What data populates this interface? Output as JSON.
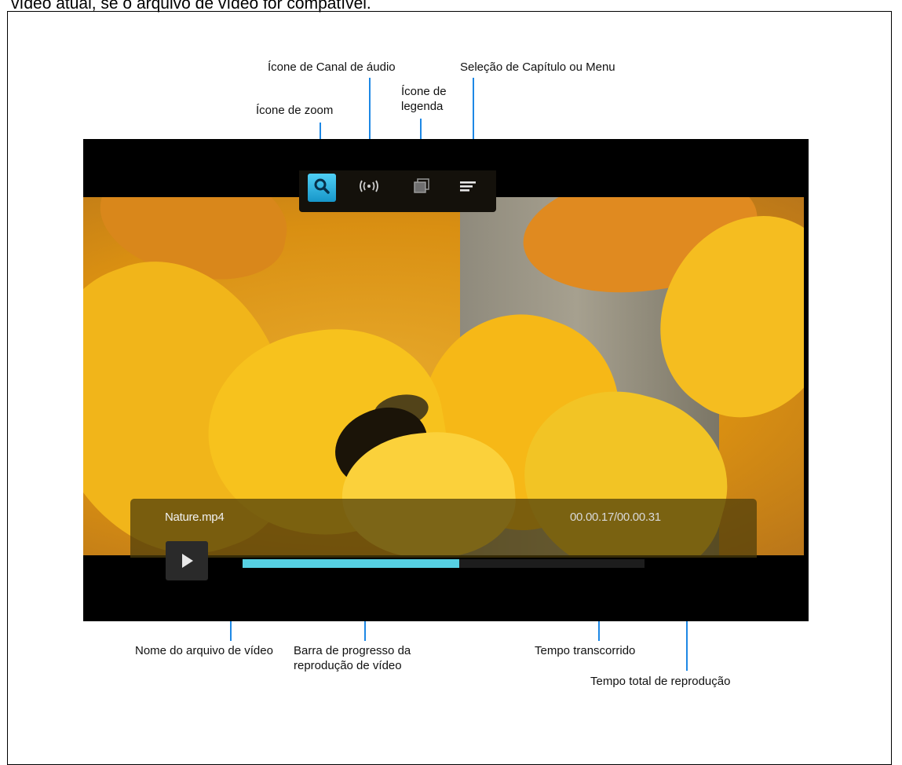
{
  "top_text": "vídeo atual, se o arquivo de vídeo for compatível.",
  "callouts": {
    "zoom_icon": "Ícone de zoom",
    "audio_channel_icon": "Ícone de Canal de áudio",
    "subtitle_icon": "Ícone de legenda",
    "chapter_menu": "Seleção de Capítulo ou Menu",
    "video_filename": "Nome do arquivo de vídeo",
    "progress_bar": "Barra de progresso da reprodução de vídeo",
    "elapsed_time": "Tempo transcorrido",
    "total_time": "Tempo total de reprodução"
  },
  "player": {
    "filename": "Nature.mp4",
    "time_display": "00.00.17/00.00.31",
    "progress_fraction": 0.54
  },
  "icons": [
    "search-icon",
    "audio-channel-icon",
    "subtitle-icon",
    "menu-icon",
    "play-icon"
  ],
  "colors": {
    "callout_line": "#1e88e5",
    "progress_fill": "#56d0e3",
    "zoom_highlight": "#2bb6e6"
  }
}
